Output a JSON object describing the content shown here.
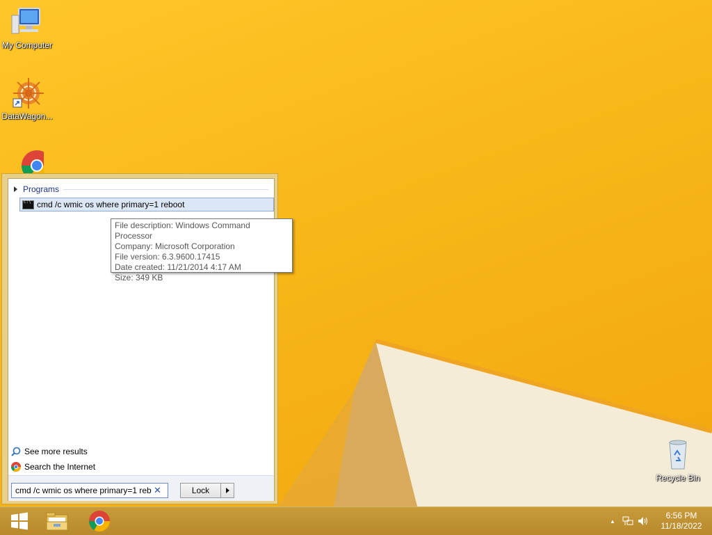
{
  "desktop": {
    "icons": [
      {
        "label": "My Computer"
      },
      {
        "label": "DataWagon..."
      },
      {
        "label": "Google Chrome"
      },
      {
        "label": "Recycle Bin"
      }
    ]
  },
  "start_menu": {
    "section_title": "Programs",
    "result": {
      "label": "cmd /c wmic os where primary=1 reboot",
      "icon": "cmd-icon"
    },
    "see_more": "See more results",
    "search_internet": "Search the Internet",
    "search_value": "cmd /c wmic os where primary=1 reb",
    "clear_glyph": "✕",
    "lock_label": "Lock"
  },
  "tooltip": {
    "lines": [
      "File description: Windows Command Processor",
      "Company: Microsoft Corporation",
      "File version: 6.3.9600.17415",
      "Date created: 11/21/2014 4:17 AM",
      "Size: 349 KB"
    ]
  },
  "taskbar": {
    "buttons": [
      "start-button",
      "file-explorer",
      "chrome"
    ],
    "tray_arrow": "▲",
    "clock": {
      "time": "6:56 PM",
      "date": "11/18/2022"
    }
  },
  "colors": {
    "wallpaper": "#f7b918",
    "taskbar": "#c79a3a",
    "selection": "#dce7f6",
    "link": "#1e3287"
  }
}
